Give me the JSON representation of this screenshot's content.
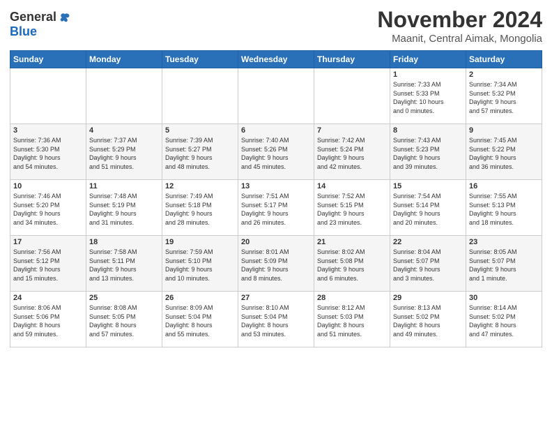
{
  "header": {
    "logo_general": "General",
    "logo_blue": "Blue",
    "month": "November 2024",
    "location": "Maanit, Central Aimak, Mongolia"
  },
  "weekdays": [
    "Sunday",
    "Monday",
    "Tuesday",
    "Wednesday",
    "Thursday",
    "Friday",
    "Saturday"
  ],
  "weeks": [
    [
      {
        "day": "",
        "info": ""
      },
      {
        "day": "",
        "info": ""
      },
      {
        "day": "",
        "info": ""
      },
      {
        "day": "",
        "info": ""
      },
      {
        "day": "",
        "info": ""
      },
      {
        "day": "1",
        "info": "Sunrise: 7:33 AM\nSunset: 5:33 PM\nDaylight: 10 hours\nand 0 minutes."
      },
      {
        "day": "2",
        "info": "Sunrise: 7:34 AM\nSunset: 5:32 PM\nDaylight: 9 hours\nand 57 minutes."
      }
    ],
    [
      {
        "day": "3",
        "info": "Sunrise: 7:36 AM\nSunset: 5:30 PM\nDaylight: 9 hours\nand 54 minutes."
      },
      {
        "day": "4",
        "info": "Sunrise: 7:37 AM\nSunset: 5:29 PM\nDaylight: 9 hours\nand 51 minutes."
      },
      {
        "day": "5",
        "info": "Sunrise: 7:39 AM\nSunset: 5:27 PM\nDaylight: 9 hours\nand 48 minutes."
      },
      {
        "day": "6",
        "info": "Sunrise: 7:40 AM\nSunset: 5:26 PM\nDaylight: 9 hours\nand 45 minutes."
      },
      {
        "day": "7",
        "info": "Sunrise: 7:42 AM\nSunset: 5:24 PM\nDaylight: 9 hours\nand 42 minutes."
      },
      {
        "day": "8",
        "info": "Sunrise: 7:43 AM\nSunset: 5:23 PM\nDaylight: 9 hours\nand 39 minutes."
      },
      {
        "day": "9",
        "info": "Sunrise: 7:45 AM\nSunset: 5:22 PM\nDaylight: 9 hours\nand 36 minutes."
      }
    ],
    [
      {
        "day": "10",
        "info": "Sunrise: 7:46 AM\nSunset: 5:20 PM\nDaylight: 9 hours\nand 34 minutes."
      },
      {
        "day": "11",
        "info": "Sunrise: 7:48 AM\nSunset: 5:19 PM\nDaylight: 9 hours\nand 31 minutes."
      },
      {
        "day": "12",
        "info": "Sunrise: 7:49 AM\nSunset: 5:18 PM\nDaylight: 9 hours\nand 28 minutes."
      },
      {
        "day": "13",
        "info": "Sunrise: 7:51 AM\nSunset: 5:17 PM\nDaylight: 9 hours\nand 26 minutes."
      },
      {
        "day": "14",
        "info": "Sunrise: 7:52 AM\nSunset: 5:15 PM\nDaylight: 9 hours\nand 23 minutes."
      },
      {
        "day": "15",
        "info": "Sunrise: 7:54 AM\nSunset: 5:14 PM\nDaylight: 9 hours\nand 20 minutes."
      },
      {
        "day": "16",
        "info": "Sunrise: 7:55 AM\nSunset: 5:13 PM\nDaylight: 9 hours\nand 18 minutes."
      }
    ],
    [
      {
        "day": "17",
        "info": "Sunrise: 7:56 AM\nSunset: 5:12 PM\nDaylight: 9 hours\nand 15 minutes."
      },
      {
        "day": "18",
        "info": "Sunrise: 7:58 AM\nSunset: 5:11 PM\nDaylight: 9 hours\nand 13 minutes."
      },
      {
        "day": "19",
        "info": "Sunrise: 7:59 AM\nSunset: 5:10 PM\nDaylight: 9 hours\nand 10 minutes."
      },
      {
        "day": "20",
        "info": "Sunrise: 8:01 AM\nSunset: 5:09 PM\nDaylight: 9 hours\nand 8 minutes."
      },
      {
        "day": "21",
        "info": "Sunrise: 8:02 AM\nSunset: 5:08 PM\nDaylight: 9 hours\nand 6 minutes."
      },
      {
        "day": "22",
        "info": "Sunrise: 8:04 AM\nSunset: 5:07 PM\nDaylight: 9 hours\nand 3 minutes."
      },
      {
        "day": "23",
        "info": "Sunrise: 8:05 AM\nSunset: 5:07 PM\nDaylight: 9 hours\nand 1 minute."
      }
    ],
    [
      {
        "day": "24",
        "info": "Sunrise: 8:06 AM\nSunset: 5:06 PM\nDaylight: 8 hours\nand 59 minutes."
      },
      {
        "day": "25",
        "info": "Sunrise: 8:08 AM\nSunset: 5:05 PM\nDaylight: 8 hours\nand 57 minutes."
      },
      {
        "day": "26",
        "info": "Sunrise: 8:09 AM\nSunset: 5:04 PM\nDaylight: 8 hours\nand 55 minutes."
      },
      {
        "day": "27",
        "info": "Sunrise: 8:10 AM\nSunset: 5:04 PM\nDaylight: 8 hours\nand 53 minutes."
      },
      {
        "day": "28",
        "info": "Sunrise: 8:12 AM\nSunset: 5:03 PM\nDaylight: 8 hours\nand 51 minutes."
      },
      {
        "day": "29",
        "info": "Sunrise: 8:13 AM\nSunset: 5:02 PM\nDaylight: 8 hours\nand 49 minutes."
      },
      {
        "day": "30",
        "info": "Sunrise: 8:14 AM\nSunset: 5:02 PM\nDaylight: 8 hours\nand 47 minutes."
      }
    ]
  ]
}
